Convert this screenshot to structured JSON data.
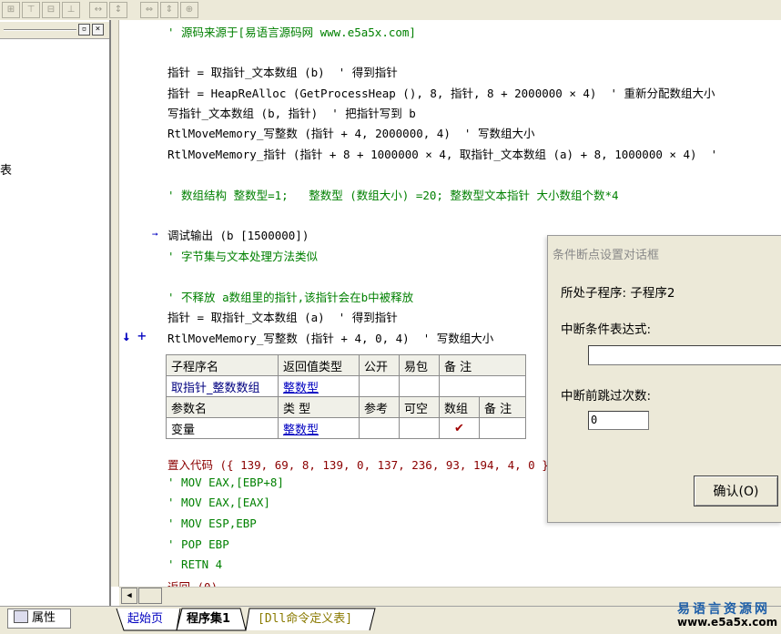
{
  "toolbar": {
    "icons": [
      "grid-icon",
      "align-top-icon",
      "align-middle-icon",
      "align-bottom-icon",
      "space-horizontal-icon",
      "space-vertical-icon",
      "width-icon",
      "height-icon",
      "size-icon"
    ]
  },
  "left_panel": {
    "partial_text": "表",
    "min_glyph": "▫",
    "close_glyph": "×"
  },
  "code": [
    {
      "t": "comment",
      "text": "' 源码来源于[易语言源码网 www.e5a5x.com]"
    },
    {
      "t": "code",
      "text": "指针 = 取指针_文本数组 (b)  ' 得到指针"
    },
    {
      "t": "code",
      "text": "指针 = HeapReAlloc (GetProcessHeap (), 8, 指针, 8 + 2000000 × 4)  ' 重新分配数组大小"
    },
    {
      "t": "code",
      "text": "写指针_文本数组 (b, 指针)  ' 把指针写到 b"
    },
    {
      "t": "code",
      "text": "RtlMoveMemory_写整数 (指针 + 4, 2000000, 4)  ' 写数组大小"
    },
    {
      "t": "code",
      "text": "RtlMoveMemory_指针 (指针 + 8 + 1000000 × 4, 取指针_文本数组 (a) + 8, 1000000 × 4)  '"
    },
    {
      "t": "comment",
      "text": "' 数组结构 整数型=1;   整数型 (数组大小) =20; 整数型文本指针 大小数组个数*4"
    },
    {
      "t": "code",
      "text": "调试输出 (b [1500000])"
    },
    {
      "t": "comment",
      "text": "' 字节集与文本处理方法类似"
    },
    {
      "t": "comment",
      "text": "' 不释放 a数组里的指针,该指针会在b中被释放"
    },
    {
      "t": "code",
      "text": "指针 = 取指针_文本数组 (a)  ' 得到指针"
    },
    {
      "t": "code",
      "text": "RtlMoveMemory_写整数 (指针 + 4, 0, 4)  ' 写数组大小"
    },
    {
      "t": "code",
      "text": "置入代码 ({ 139, 69, 8, 139, 0, 137, 236, 93, 194, 4, 0 })"
    },
    {
      "t": "comment",
      "text": "' MOV EAX,[EBP+8]"
    },
    {
      "t": "comment",
      "text": "' MOV EAX,[EAX]"
    },
    {
      "t": "comment",
      "text": "' MOV ESP,EBP"
    },
    {
      "t": "comment",
      "text": "' POP EBP"
    },
    {
      "t": "comment",
      "text": "' RETN 4"
    },
    {
      "t": "code",
      "text": "返回 (0)"
    }
  ],
  "markers": {
    "arrow": "↓",
    "plus": "+",
    "exec": "➞"
  },
  "sub_table": {
    "headers": [
      "子程序名",
      "返回值类型",
      "公开",
      "易包",
      "备 注"
    ],
    "row": [
      "取指针_整数数组",
      "整数型",
      "",
      "",
      ""
    ],
    "param_headers": [
      "参数名",
      "类 型",
      "参考",
      "可空",
      "数组",
      "备 注"
    ],
    "param_row": [
      "变量",
      "整数型",
      "",
      "",
      "✔",
      ""
    ]
  },
  "dialog": {
    "title": "条件断点设置对话框",
    "subprogram_label": "所处子程序: 子程序2",
    "condition_label": "中断条件表达式:",
    "condition_value": "",
    "skip_label": "中断前跳过次数:",
    "skip_value": "0",
    "ok_label": "确认(O)"
  },
  "bottom": {
    "props_label": "属性",
    "tabs": [
      "起始页",
      "程序集1",
      "[Dll命令定义表]"
    ],
    "scroll_left": "◀"
  },
  "watermark": {
    "line1": "易语言资源网",
    "line2": "www.e5a5x.com"
  }
}
